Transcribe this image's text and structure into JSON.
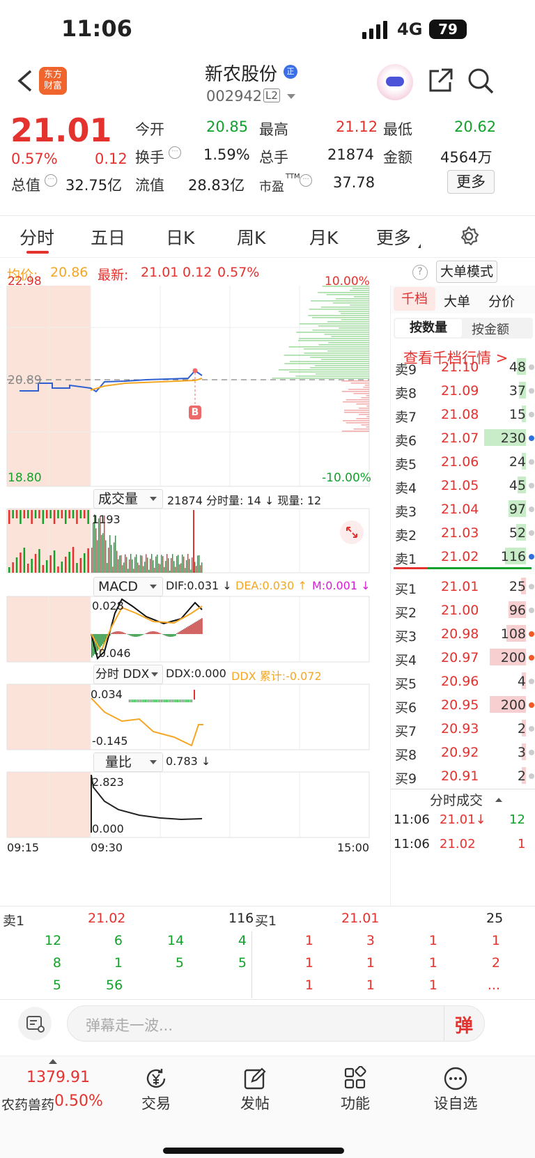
{
  "status": {
    "time": "11:06",
    "network": "4G",
    "battery": "79"
  },
  "header": {
    "name": "新农股份",
    "code": "002942",
    "level": "L2",
    "app_logo": "东方\n财富",
    "badge": "正"
  },
  "quote": {
    "price": "21.01",
    "pct": "0.57%",
    "chg": "0.12",
    "rows": [
      [
        {
          "k": "今开",
          "v": "20.85",
          "c": "g"
        },
        {
          "k": "最高",
          "v": "21.12",
          "c": "r"
        },
        {
          "k": "最低",
          "v": "20.62",
          "c": "g"
        }
      ],
      [
        {
          "k": "换手",
          "v": "1.59%",
          "c": ""
        },
        {
          "k": "总手",
          "v": "21874",
          "c": ""
        },
        {
          "k": "金额",
          "v": "4564万",
          "c": ""
        }
      ],
      [
        {
          "k": "总值",
          "v": "32.75亿",
          "c": ""
        },
        {
          "k": "流值",
          "v": "28.83亿",
          "c": ""
        },
        {
          "k": "市盈",
          "v": "37.78",
          "c": ""
        }
      ]
    ],
    "more": "更多",
    "ttm": "TTM"
  },
  "tabs": [
    "分时",
    "五日",
    "日K",
    "周K",
    "月K",
    "更多"
  ],
  "info": {
    "avg_label": "均价:",
    "avg": "20.86",
    "last_label": "最新:",
    "last": "21.01",
    "chg": "0.12",
    "pct": "0.57%",
    "mode": "大单模式"
  },
  "chart": {
    "y_top": "22.98",
    "y_mid": "20.89",
    "y_bot": "18.80",
    "pct_top": "10.00%",
    "pct_bot": "-10.00%",
    "marker": "B",
    "t_start": "09:15",
    "t_open": "09:30",
    "t_end": "15:00"
  },
  "vol": {
    "title": "成交量",
    "summary": "21874 分时量: 14 ↓ 现量: 12",
    "max": "1193"
  },
  "macd": {
    "title": "MACD",
    "dif": "DIF:0.031 ↓",
    "dea": "DEA:0.030 ↑",
    "m": "M:0.001 ↓",
    "top": "0.028",
    "bot": "-0.046"
  },
  "ddx": {
    "title": "分时 DDX",
    "ddx": "DDX:0.000",
    "cum": "DDX 累计:-0.072",
    "top": "0.034",
    "bot": "-0.145"
  },
  "lb": {
    "title": "量比",
    "val": "0.783 ↓",
    "top": "2.823",
    "bot": "0.000"
  },
  "side": {
    "tabs": [
      "千档",
      "大单",
      "分价"
    ],
    "sub": [
      "按数量",
      "按金额"
    ],
    "link": "查看千档行情 >",
    "asks": [
      [
        "卖9",
        "21.10",
        "48"
      ],
      [
        "卖8",
        "21.09",
        "37"
      ],
      [
        "卖7",
        "21.08",
        "15"
      ],
      [
        "卖6",
        "21.07",
        "230"
      ],
      [
        "卖5",
        "21.06",
        "24"
      ],
      [
        "卖4",
        "21.05",
        "45"
      ],
      [
        "卖3",
        "21.04",
        "97"
      ],
      [
        "卖2",
        "21.03",
        "52"
      ],
      [
        "卖1",
        "21.02",
        "116"
      ]
    ],
    "bids": [
      [
        "买1",
        "21.01",
        "25"
      ],
      [
        "买2",
        "21.00",
        "96"
      ],
      [
        "买3",
        "20.98",
        "108"
      ],
      [
        "买4",
        "20.97",
        "200"
      ],
      [
        "买5",
        "20.96",
        "4"
      ],
      [
        "买6",
        "20.95",
        "200"
      ],
      [
        "买7",
        "20.93",
        "2"
      ],
      [
        "买8",
        "20.92",
        "3"
      ],
      [
        "买9",
        "20.91",
        "2"
      ]
    ],
    "trades_title": "分时成交",
    "trades": [
      [
        "11:06",
        "21.01↓",
        "12"
      ],
      [
        "11:06",
        "21.02",
        "1"
      ]
    ]
  },
  "queue": {
    "ask_label": "卖1",
    "ask_price": "21.02",
    "ask_vol": "116",
    "bid_label": "买1",
    "bid_price": "21.01",
    "bid_vol": "25",
    "ask_q": [
      [
        "12",
        "6",
        "14",
        "4"
      ],
      [
        "8",
        "1",
        "5",
        "5"
      ],
      [
        "5",
        "56",
        "",
        ""
      ]
    ],
    "bid_q": [
      [
        "1",
        "3",
        "1",
        "1"
      ],
      [
        "1",
        "1",
        "1",
        "2"
      ],
      [
        "1",
        "1",
        "1",
        "..."
      ]
    ]
  },
  "danmu": {
    "placeholder": "弹幕走一波...",
    "btn": "弹"
  },
  "bottom": {
    "sector_val": "1379.91",
    "sector_name": "农药兽药",
    "sector_pct": "0.50%",
    "items": [
      "交易",
      "发帖",
      "功能",
      "设自选"
    ]
  }
}
